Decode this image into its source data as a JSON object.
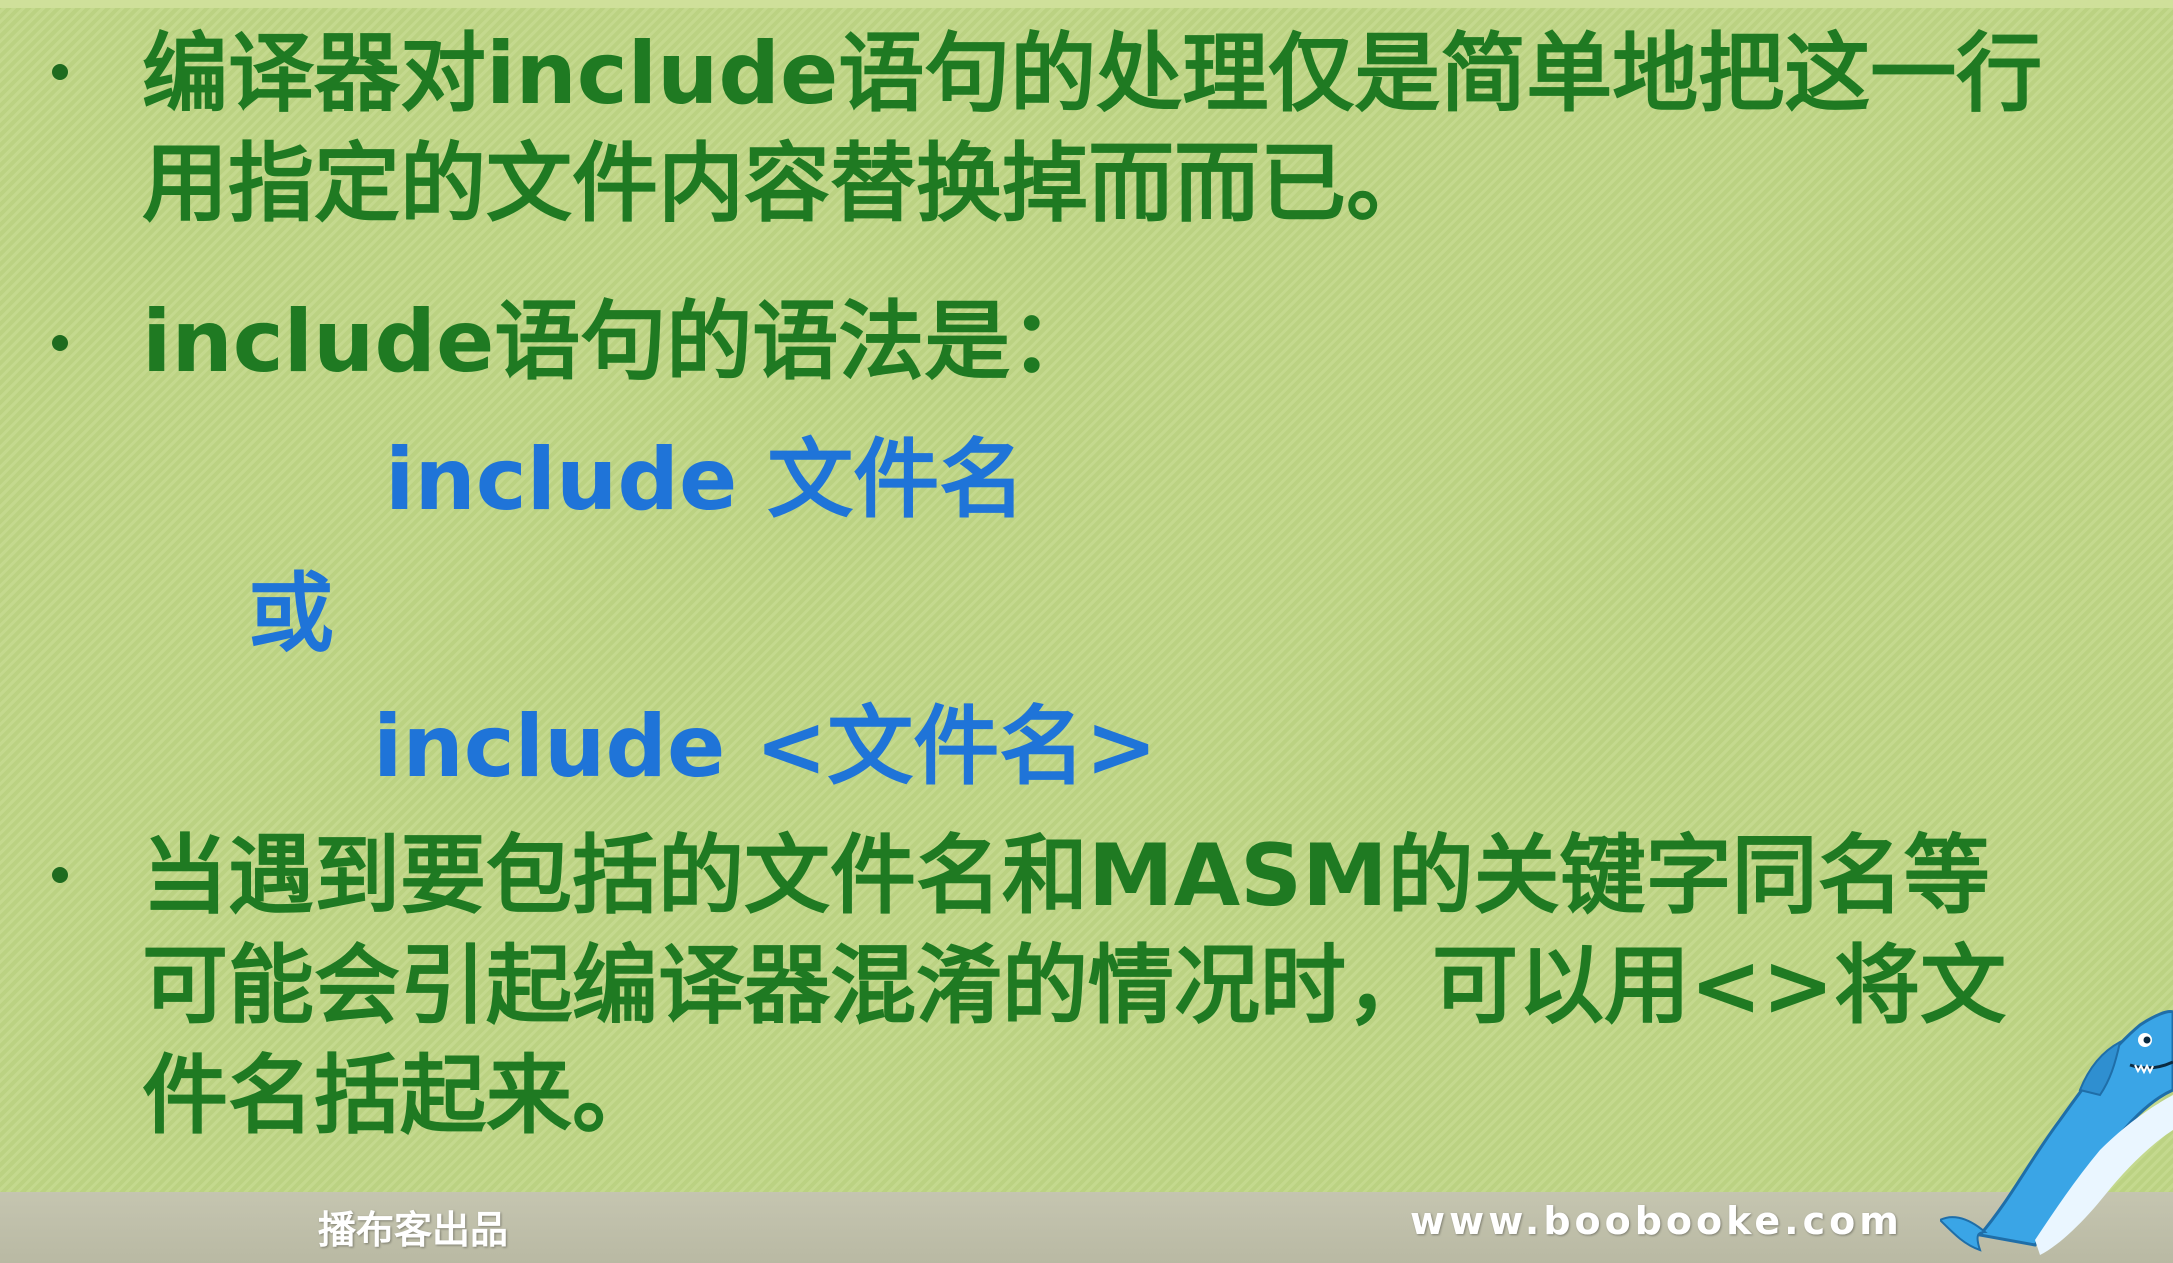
{
  "slide": {
    "bullets": [
      {
        "lines": [
          "编译器对include语句的处理仅是简单地把这一行",
          "用指定的文件内容替换掉而而已。"
        ]
      },
      {
        "lines": [
          "include语句的语法是："
        ]
      },
      {
        "lines": [
          "当遇到要包括的文件名和MASM的关键字同名等",
          "可能会引起编译器混淆的情况时，可以用<>将文",
          "件名括起来。"
        ]
      }
    ],
    "syntax": {
      "form1": "include 文件名",
      "or": "或",
      "form2": "include <文件名>"
    }
  },
  "footer": {
    "brand": "播布客出品",
    "site": "www.boobooke.com"
  },
  "icons": {
    "mascot": "shark-mascot-icon"
  },
  "colors": {
    "background": "#bfd685",
    "bullet_text": "#1f7a22",
    "syntax_text": "#1f74d8"
  }
}
